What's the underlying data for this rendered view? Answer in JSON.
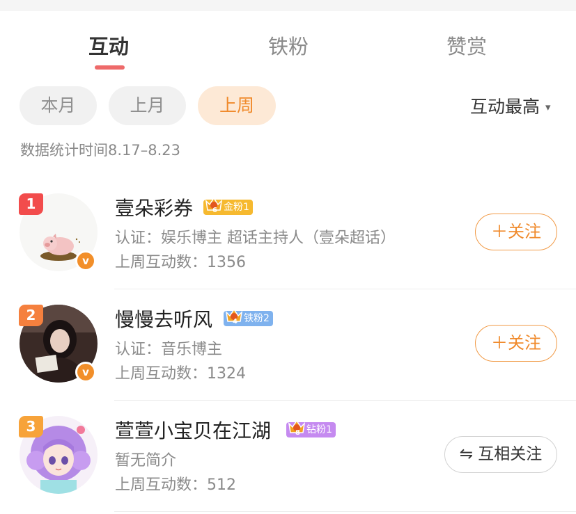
{
  "tabs": [
    "互动",
    "铁粉",
    "赞赏"
  ],
  "filters": [
    "本月",
    "上月",
    "上周"
  ],
  "sort_label": "互动最高",
  "sort_caret": "▾",
  "stats_text": "数据统计时间8.17–8.23",
  "rows": [
    {
      "rank": "1",
      "name": "壹朵彩券",
      "badge_level": "6",
      "badge_label": "金粉1",
      "desc": "认证：娱乐博主 超话主持人（壹朵超话）",
      "count": "上周互动数：1356",
      "verified": "v",
      "button": "＋关注"
    },
    {
      "rank": "2",
      "name": "慢慢去听风",
      "badge_level": "4",
      "badge_label": "铁粉2",
      "desc": "认证：音乐博主",
      "count": "上周互动数：1324",
      "verified": "v",
      "button": "＋关注"
    },
    {
      "rank": "3",
      "name": "萱萱小宝贝在江湖",
      "badge_level": "8",
      "badge_label": "钻粉1",
      "desc": "暂无简介",
      "count": "上周互动数：512",
      "button": "⇋ 互相关注"
    }
  ],
  "colors": {
    "accent": "#f08a2b",
    "tab_underline": "#ee6a6a",
    "rank1": "#f24c4c",
    "rank2": "#f5803e",
    "rank3": "#f7a33a",
    "gold_badge": "#f6b92f",
    "iron_badge": "#7fb2ee",
    "diamond_badge": "#c58af0"
  },
  "icons": [
    "crown-icon",
    "verified-v-icon",
    "caret-down-icon",
    "mutual-follow-icon"
  ]
}
